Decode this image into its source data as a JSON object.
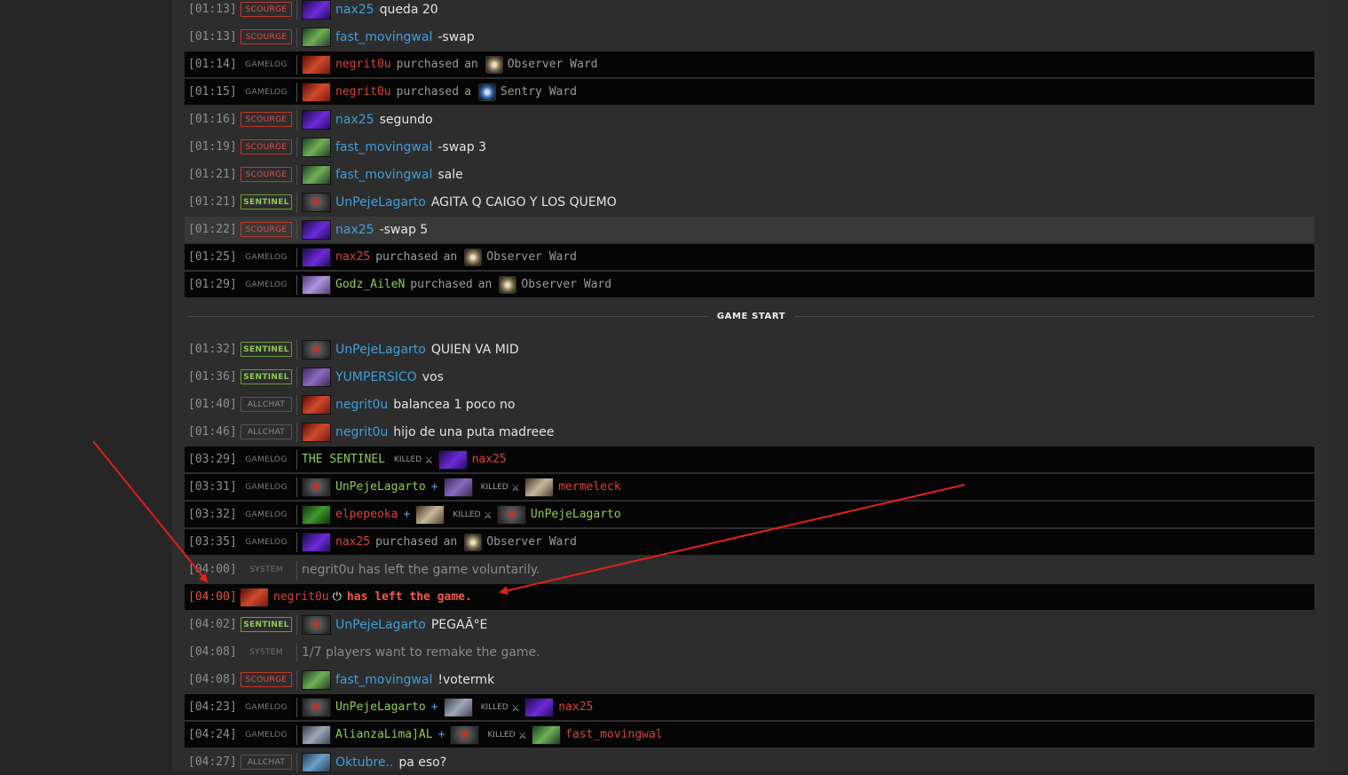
{
  "divider_label": "GAME START",
  "colors": {
    "accent_blue": "#3e9fdb",
    "scourge": "#e0524a",
    "sentinel": "#93c85a",
    "annotation_arrow": "#e0201a"
  },
  "rows": [
    {
      "time": "[01:13]",
      "badge": "SCOURGE",
      "name": "nax25",
      "message": "queda 20"
    },
    {
      "time": "[01:13]",
      "badge": "SCOURGE",
      "name": "fast_movingwal",
      "message": "-swap"
    },
    {
      "time": "[01:14]",
      "badge": "GAMELOG",
      "name": "negrit0u",
      "verb": "purchased",
      "article": "an",
      "item": "Observer Ward"
    },
    {
      "time": "[01:15]",
      "badge": "GAMELOG",
      "name": "negrit0u",
      "verb": "purchased",
      "article": "a",
      "item": "Sentry Ward"
    },
    {
      "time": "[01:16]",
      "badge": "SCOURGE",
      "name": "nax25",
      "message": "segundo"
    },
    {
      "time": "[01:19]",
      "badge": "SCOURGE",
      "name": "fast_movingwal",
      "message": "-swap 3"
    },
    {
      "time": "[01:21]",
      "badge": "SCOURGE",
      "name": "fast_movingwal",
      "message": "sale"
    },
    {
      "time": "[01:21]",
      "badge": "SENTINEL",
      "name": "UnPejeLagarto",
      "message": "AGITA Q CAIGO Y LOS QUEMO"
    },
    {
      "time": "[01:22]",
      "badge": "SCOURGE",
      "name": "nax25",
      "message": "-swap 5"
    },
    {
      "time": "[01:25]",
      "badge": "GAMELOG",
      "name": "nax25",
      "verb": "purchased",
      "article": "an",
      "item": "Observer Ward"
    },
    {
      "time": "[01:29]",
      "badge": "GAMELOG",
      "name": "Godz_AileN",
      "verb": "purchased",
      "article": "an",
      "item": "Observer Ward"
    },
    {
      "time": "[01:32]",
      "badge": "SENTINEL",
      "name": "UnPejeLagarto",
      "message": "QUIEN VA MID"
    },
    {
      "time": "[01:36]",
      "badge": "SENTINEL",
      "name": "YUMPERSICO",
      "message": "vos"
    },
    {
      "time": "[01:40]",
      "badge": "ALLCHAT",
      "name": "negrit0u",
      "message": "balancea 1 poco no"
    },
    {
      "time": "[01:46]",
      "badge": "ALLCHAT",
      "name": "negrit0u",
      "message": "hijo de una puta madreee"
    },
    {
      "time": "[03:29]",
      "badge": "GAMELOG",
      "killer": "THE SENTINEL",
      "killed_label": "KILLED",
      "victim": "nax25"
    },
    {
      "time": "[03:31]",
      "badge": "GAMELOG",
      "killer": "UnPejeLagarto",
      "plus": "+",
      "killed_label": "KILLED",
      "victim": "mermeleck"
    },
    {
      "time": "[03:32]",
      "badge": "GAMELOG",
      "killer": "elpepeoka",
      "plus": "+",
      "killed_label": "KILLED",
      "victim": "UnPejeLagarto"
    },
    {
      "time": "[03:35]",
      "badge": "GAMELOG",
      "name": "nax25",
      "verb": "purchased",
      "article": "an",
      "item": "Observer Ward"
    },
    {
      "time": "[04:00]",
      "badge": "SYSTEM",
      "message": "negrit0u has left the game voluntarily."
    },
    {
      "time": "[04:00]",
      "name": "negrit0u",
      "message": "has left the game."
    },
    {
      "time": "[04:02]",
      "badge": "SENTINEL",
      "name": "UnPejeLagarto",
      "message": "PEGAÃ°E"
    },
    {
      "time": "[04:08]",
      "badge": "SYSTEM",
      "message": "1/7 players want to remake the game."
    },
    {
      "time": "[04:08]",
      "badge": "SCOURGE",
      "name": "fast_movingwal",
      "message": "!votermk"
    },
    {
      "time": "[04:23]",
      "badge": "GAMELOG",
      "killer": "UnPejeLagarto",
      "plus": "+",
      "killed_label": "KILLED",
      "victim": "nax25"
    },
    {
      "time": "[04:24]",
      "badge": "GAMELOG",
      "killer": "AlianzaLima]AL",
      "plus": "+",
      "killed_label": "KILLED",
      "victim": "fast_movingwal"
    },
    {
      "time": "[04:27]",
      "badge": "ALLCHAT",
      "name": "Oktubre..",
      "message": "pa eso?"
    }
  ]
}
